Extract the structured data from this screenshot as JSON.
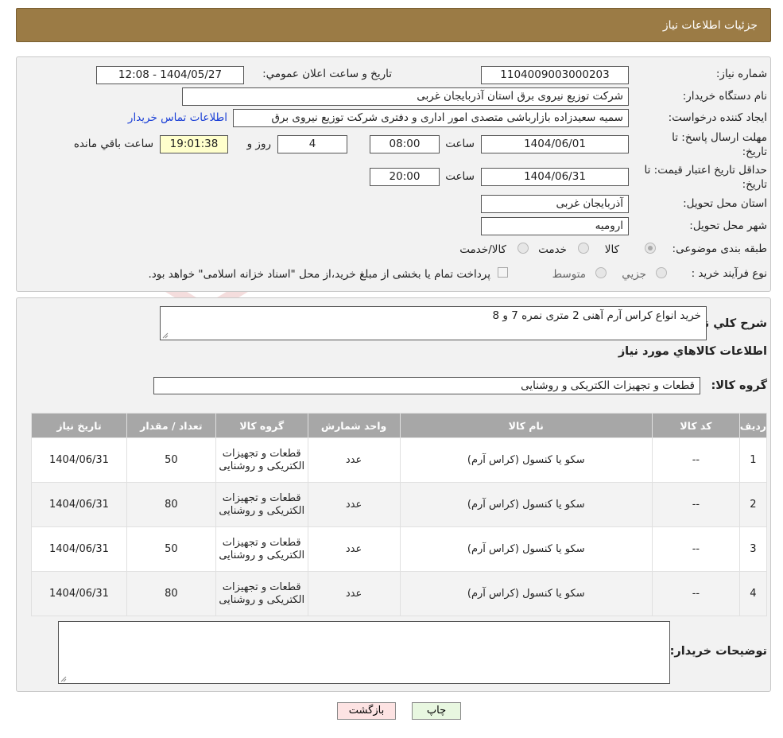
{
  "header": {
    "title": "جزئیات اطلاعات نیاز"
  },
  "watermark": {
    "brand": "AriaTender.neT"
  },
  "form": {
    "need_number_label": "شماره نیاز:",
    "need_number": "1104009003000203",
    "announce_label": "تاریخ و ساعت اعلان عمومي:",
    "announce_value": "1404/05/27 - 12:08",
    "buyer_org_label": "نام دستگاه خریدار:",
    "buyer_org": "شرکت توزیع نیروی برق استان آذربایجان غربی",
    "creator_label": "ایجاد کننده درخواست:",
    "creator": "سمیه سعیدزاده بازارباشی متصدی امور اداری و دفتری  شرکت توزیع نیروی برق",
    "contact_link": "اطلاعات تماس خریدار",
    "deadline_label_1": "مهلت ارسال پاسخ: تا",
    "deadline_label_2": "تاریخ:",
    "deadline_date": "1404/06/01",
    "time_label": "ساعت",
    "deadline_time": "08:00",
    "days": "4",
    "days_label": "روز و",
    "remaining_time": "19:01:38",
    "remaining_label": "ساعت باقي مانده",
    "validity_label_1": "حداقل تاریخ اعتبار قیمت: تا",
    "validity_label_2": "تاریخ:",
    "validity_date": "1404/06/31",
    "validity_time_label": "ساعت",
    "validity_time": "20:00",
    "province_label": "استان محل تحویل:",
    "province": "آذربایجان غربی",
    "city_label": "شهر محل تحویل:",
    "city": "ارومیه",
    "category_label": "طبقه بندی موضوعی:",
    "category_options": [
      "کالا",
      "خدمت",
      "کالا/خدمت"
    ],
    "process_label": "نوع فرآیند خرید :",
    "process_options": [
      "جزيي",
      "متوسط"
    ],
    "payment_note": "پرداخت تمام یا بخشی از مبلغ خرید،از محل \"اسناد خزانه اسلامی\" خواهد بود."
  },
  "details": {
    "description_label": "شرح کلي نیاز:",
    "description": "خرید انواع کراس آرم آهنی 2 متری نمره 7 و 8",
    "goods_info_title": "اطلاعات کالاهاي مورد نیاز",
    "group_label": "گروه کالا:",
    "group_value": "قطعات و تجهیزات الکتریکی و روشنایی",
    "table": {
      "headers": [
        "ردیف",
        "کد کالا",
        "نام کالا",
        "واحد شمارش",
        "گروه کالا",
        "تعداد / مقدار",
        "تاریخ نیاز"
      ],
      "rows": [
        {
          "idx": "1",
          "code": "--",
          "name": "سکو یا کنسول (کراس آرم)",
          "unit": "عدد",
          "group": "قطعات و تجهیزات الکتریکی و روشنایی",
          "qty": "50",
          "date": "1404/06/31"
        },
        {
          "idx": "2",
          "code": "--",
          "name": "سکو یا کنسول (کراس آرم)",
          "unit": "عدد",
          "group": "قطعات و تجهیزات الکتریکی و روشنایی",
          "qty": "80",
          "date": "1404/06/31"
        },
        {
          "idx": "3",
          "code": "--",
          "name": "سکو یا کنسول (کراس آرم)",
          "unit": "عدد",
          "group": "قطعات و تجهیزات الکتریکی و روشنایی",
          "qty": "50",
          "date": "1404/06/31"
        },
        {
          "idx": "4",
          "code": "--",
          "name": "سکو یا کنسول (کراس آرم)",
          "unit": "عدد",
          "group": "قطعات و تجهیزات الکتریکی و روشنایی",
          "qty": "80",
          "date": "1404/06/31"
        }
      ]
    },
    "buyer_notes_label": "توضیحات خریدار:",
    "buyer_notes": ""
  },
  "buttons": {
    "print": "چاپ",
    "back": "بازگشت"
  }
}
